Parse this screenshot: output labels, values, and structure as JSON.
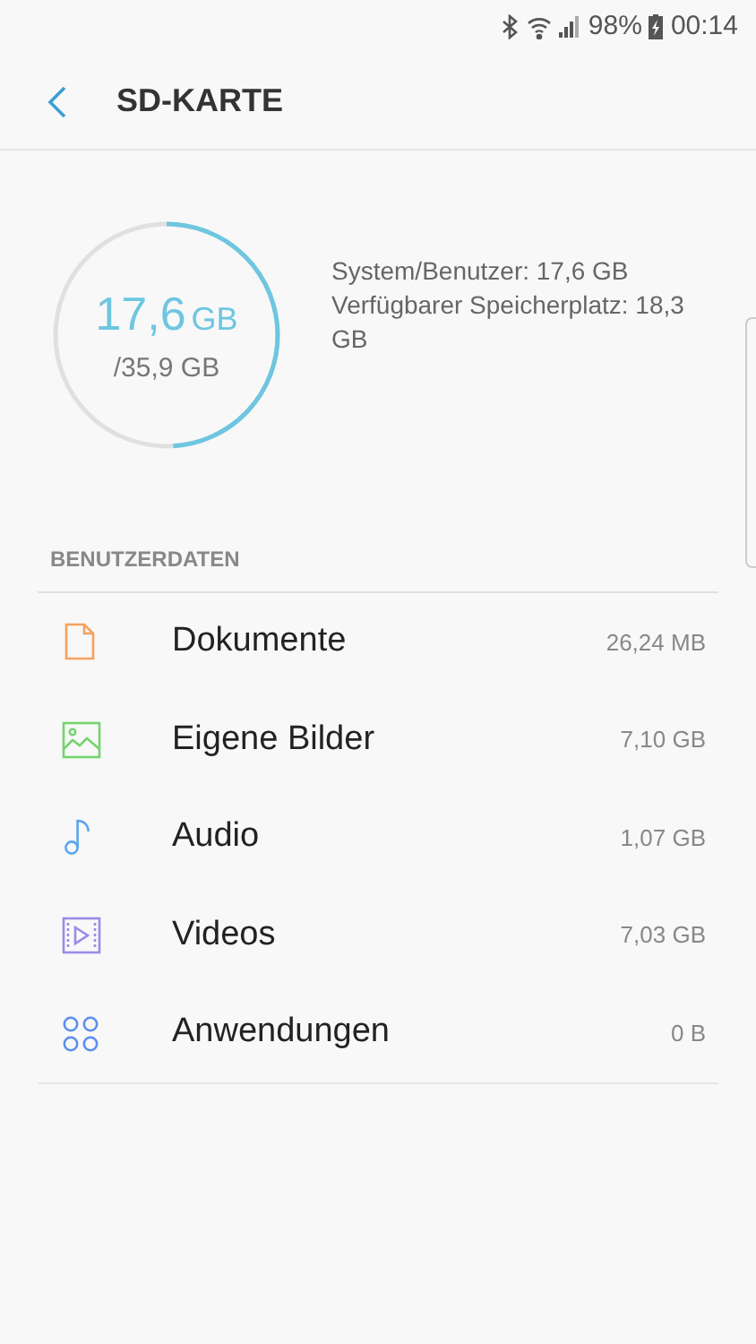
{
  "status_bar": {
    "battery": "98%",
    "time": "00:14"
  },
  "header": {
    "title": "SD-KARTE"
  },
  "storage": {
    "used": "17,6",
    "used_unit": "GB",
    "total": "/35,9 GB",
    "level": 0.49,
    "info": [
      "System/Benutzer: 17,6 GB",
      "Verfügbarer Speicherplatz: 18,3 GB"
    ]
  },
  "section": {
    "title": "BENUTZERDATEN"
  },
  "items": [
    {
      "kind": "document",
      "label": "Dokumente",
      "size": "26,24 MB",
      "color": "#f5a15c"
    },
    {
      "kind": "image",
      "label": "Eigene Bilder",
      "size": "7,10 GB",
      "color": "#74d46f"
    },
    {
      "kind": "audio",
      "label": "Audio",
      "size": "1,07 GB",
      "color": "#5aa6ec"
    },
    {
      "kind": "video",
      "label": "Videos",
      "size": "7,03 GB",
      "color": "#9d8ae8"
    },
    {
      "kind": "apps",
      "label": "Anwendungen",
      "size": "0 B",
      "color": "#5b8ff0"
    }
  ]
}
